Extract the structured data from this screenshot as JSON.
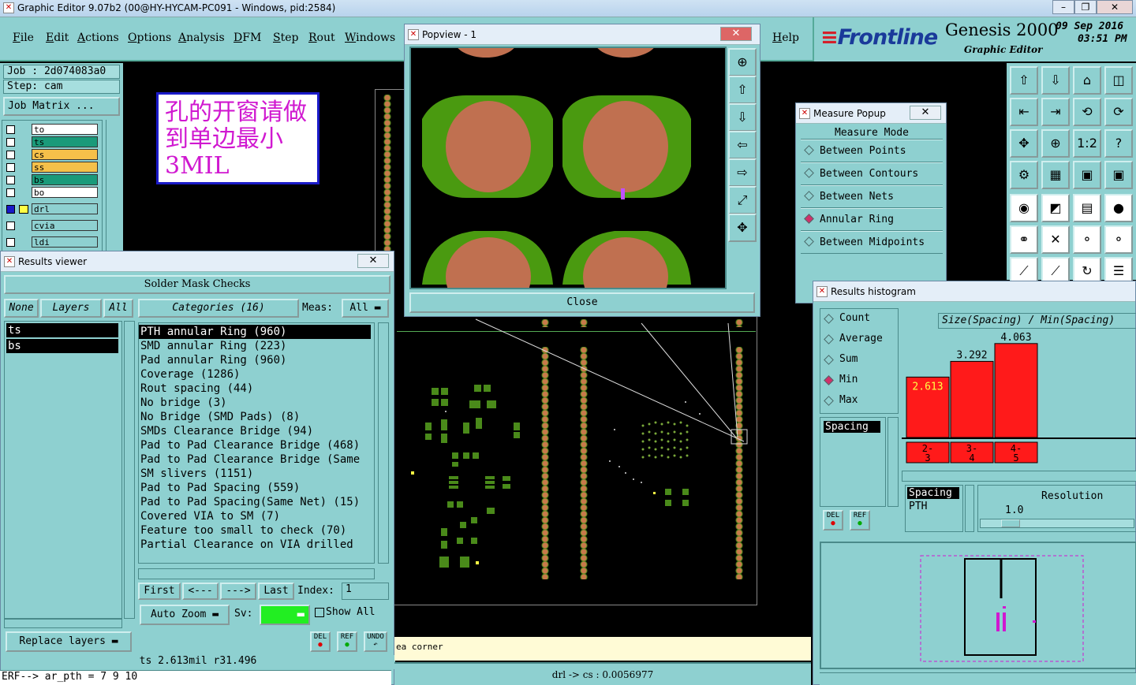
{
  "window": {
    "title": "Graphic Editor 9.07b2 (00@HY-HYCAM-PC091 - Windows, pid:2584)"
  },
  "menu": [
    "File",
    "Edit",
    "Actions",
    "Options",
    "Analysis",
    "DFM",
    "Step",
    "Rout",
    "Windows"
  ],
  "help": "Help",
  "brand": {
    "logo": "Frontline",
    "product": "Genesis 2000",
    "subtitle": "Graphic Editor",
    "date": "09 Sep 2016",
    "time": "03:51 PM"
  },
  "job": {
    "job_label": "Job : 2d074083a0",
    "step_label": "Step: cam",
    "matrix_button": "Job Matrix ..."
  },
  "layers": [
    {
      "name": "to",
      "color": "#ffffff"
    },
    {
      "name": "ts",
      "color": "#1a9a7a"
    },
    {
      "name": "cs",
      "color": "#f5c04a"
    },
    {
      "name": "ss",
      "color": "#f5c04a"
    },
    {
      "name": "bs",
      "color": "#1a9a7a"
    },
    {
      "name": "bo",
      "color": "#ffffff"
    },
    {
      "name": "drl",
      "color": "#8ed0d0"
    },
    {
      "name": "cvia",
      "color": "#8ed0d0"
    },
    {
      "name": "ldi",
      "color": "#8ed0d0"
    }
  ],
  "note": {
    "text": "孔的开窗请做到单边最小3MIL"
  },
  "results_viewer": {
    "title": "Results viewer",
    "header": "Solder Mask Checks",
    "none": "None",
    "layers": "Layers",
    "all": "All",
    "selected_layers": [
      "ts",
      "bs"
    ],
    "categories_label": "Categories (16)",
    "meas_label": "Meas:",
    "meas_value": "All",
    "categories": [
      "PTH annular Ring (960)",
      "SMD annular Ring (223)",
      "Pad annular Ring (960)",
      "Coverage (1286)",
      "Rout spacing (44)",
      "No bridge (3)",
      "No Bridge (SMD Pads) (8)",
      "SMDs Clearance Bridge (94)",
      "Pad to Pad Clearance Bridge (468)",
      "Pad to Pad Clearance Bridge (Same",
      "SM slivers (1151)",
      "Pad to Pad Spacing (559)",
      "Pad to Pad Spacing(Same Net) (15)",
      "Covered VIA to SM (7)",
      "Feature too small to check (70)",
      "Partial Clearance on VIA drilled"
    ],
    "nav": {
      "first": "First",
      "prev": "<---",
      "next": "--->",
      "last": "Last",
      "index_label": "Index:",
      "index_value": "1"
    },
    "auto_zoom": "Auto Zoom",
    "sv_label": "Sv:",
    "show_all": "Show All",
    "replace_layers": "Replace layers",
    "del": "DEL",
    "ref": "REF",
    "undo": "UNDO",
    "status": "ts 2.613mil  r31.496"
  },
  "cmdline": "ERF--> ar_pth = 7 9 10",
  "bottom_status": {
    "hint": "ea corner",
    "measure": "drl -> cs : 0.0056977"
  },
  "popview": {
    "title": "Popview - 1",
    "close": "Close"
  },
  "measure_popup": {
    "title": "Measure Popup",
    "mode_label": "Measure Mode",
    "modes": [
      {
        "label": "Between Points",
        "on": false
      },
      {
        "label": "Between Contours",
        "on": false
      },
      {
        "label": "Between Nets",
        "on": false
      },
      {
        "label": "Annular Ring",
        "on": true
      },
      {
        "label": "Between Midpoints",
        "on": false
      }
    ]
  },
  "histogram": {
    "title": "Results histogram",
    "stats": [
      {
        "label": "Count",
        "on": false
      },
      {
        "label": "Average",
        "on": false
      },
      {
        "label": "Sum",
        "on": false
      },
      {
        "label": "Min",
        "on": true
      },
      {
        "label": "Max",
        "on": false
      }
    ],
    "chart_title": "Size(Spacing) / Min(Spacing)",
    "bars": [
      {
        "value": 2.613,
        "label": "2.613",
        "bin": "2-3"
      },
      {
        "value": 3.292,
        "label": "3.292",
        "bin": "3-4"
      },
      {
        "value": 4.063,
        "label": "4.063",
        "bin": "4-5"
      }
    ],
    "bar_max": 4.5,
    "list_item": "Spacing",
    "meas_list": [
      "Spacing",
      "PTH"
    ],
    "resolution_label": "Resolution",
    "resolution_value": "1.0"
  }
}
